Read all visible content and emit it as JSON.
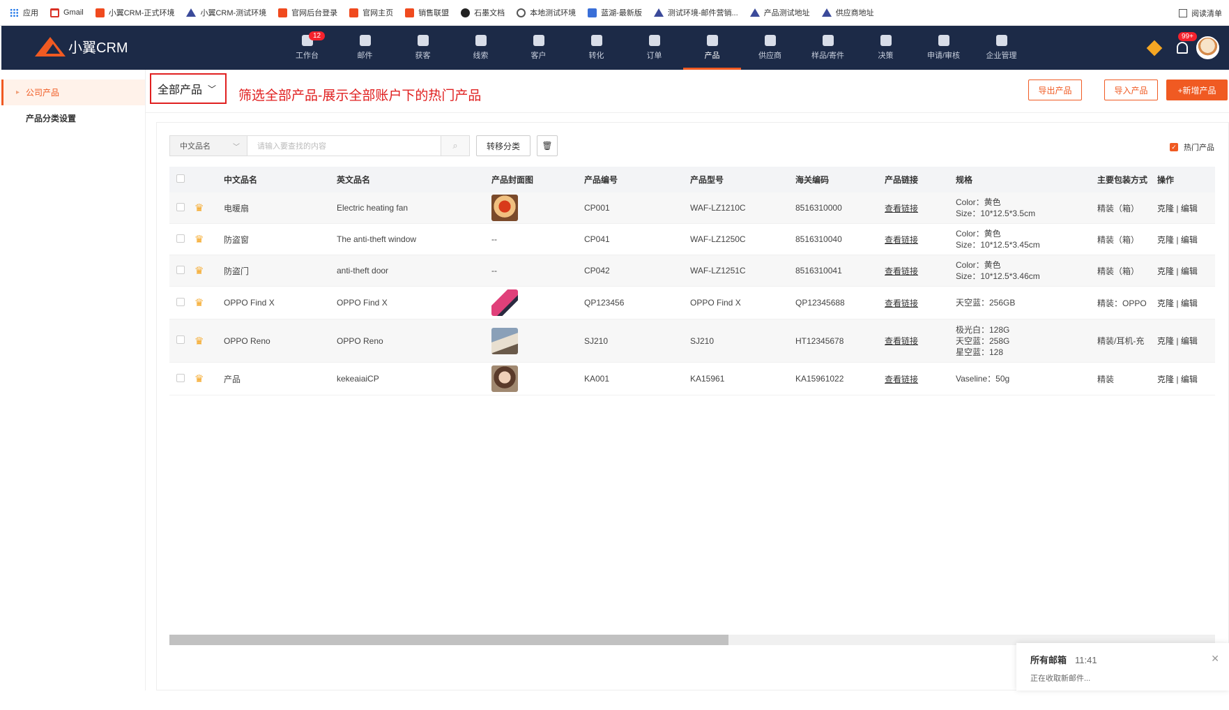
{
  "bookmarks": {
    "items": [
      {
        "label": "应用",
        "icon": "apps-grid-icon"
      },
      {
        "label": "Gmail",
        "icon": "gmail-icon"
      },
      {
        "label": "小翼CRM-正式环境",
        "icon": "crm-icon"
      },
      {
        "label": "小翼CRM-测试环境",
        "icon": "triangle-icon"
      },
      {
        "label": "官网后台登录",
        "icon": "crm-icon"
      },
      {
        "label": "官网主页",
        "icon": "crm-icon"
      },
      {
        "label": "销售联盟",
        "icon": "crm-icon"
      },
      {
        "label": "石墨文档",
        "icon": "shimo-icon"
      },
      {
        "label": "本地测试环境",
        "icon": "globe-icon"
      },
      {
        "label": "蓝湖-最新版",
        "icon": "lanhu-icon"
      },
      {
        "label": "测试环境-邮件营销...",
        "icon": "triangle-icon"
      },
      {
        "label": "产品测试地址",
        "icon": "triangle-icon"
      },
      {
        "label": "供应商地址",
        "icon": "triangle-icon"
      }
    ],
    "reading_list": "阅读清单"
  },
  "nav": {
    "brand": "小翼CRM",
    "items": [
      {
        "label": "工作台",
        "badge": "12"
      },
      {
        "label": "邮件"
      },
      {
        "label": "获客"
      },
      {
        "label": "线索"
      },
      {
        "label": "客户"
      },
      {
        "label": "转化"
      },
      {
        "label": "订单"
      },
      {
        "label": "产品",
        "active": true
      },
      {
        "label": "供应商"
      },
      {
        "label": "样品/寄件"
      },
      {
        "label": "决策"
      },
      {
        "label": "申请/审核"
      },
      {
        "label": "企业管理"
      }
    ],
    "notification_badge": "99+"
  },
  "sidebar": {
    "items": [
      {
        "label": "公司产品",
        "active": true
      },
      {
        "label": "产品分类设置"
      }
    ]
  },
  "filter": {
    "selected": "全部产品",
    "annotation": "筛选全部产品-展示全部账户下的热门产品"
  },
  "actions": {
    "export": "导出产品",
    "import": "导入产品",
    "add": "+新增产品"
  },
  "toolbar": {
    "search_type": "中文品名",
    "search_placeholder": "请输入要查找的内容",
    "move_category": "转移分类",
    "hot_label": "热门产品"
  },
  "table": {
    "headers": {
      "cn": "中文品名",
      "en": "英文品名",
      "img": "产品封面图",
      "code": "产品编号",
      "model": "产品型号",
      "hs": "海关编码",
      "link": "产品链接",
      "spec": "规格",
      "pack": "主要包装方式",
      "op": "操作"
    },
    "rows": [
      {
        "cn": "电暖扇",
        "en": "Electric heating fan",
        "img": "thumb",
        "code": "CP001",
        "model": "WAF-LZ1210C",
        "hs": "8516310000",
        "link": "查看链接",
        "spec": [
          "Color：黄色",
          "Size：10*12.5*3.5cm"
        ],
        "pack": "精装（箱）",
        "clone": "克隆",
        "edit": "编辑"
      },
      {
        "cn": "防盗窗",
        "en": "The anti-theft window",
        "img": "--",
        "code": "CP041",
        "model": "WAF-LZ1250C",
        "hs": "8516310040",
        "link": "查看链接",
        "spec": [
          "Color：黄色",
          "Size：10*12.5*3.45cm"
        ],
        "pack": "精装（箱）",
        "clone": "克隆",
        "edit": "编辑"
      },
      {
        "cn": "防盗门",
        "en": "anti-theft door",
        "img": "--",
        "code": "CP042",
        "model": "WAF-LZ1251C",
        "hs": "8516310041",
        "link": "查看链接",
        "spec": [
          "Color：黄色",
          "Size：10*12.5*3.46cm"
        ],
        "pack": "精装（箱）",
        "clone": "克隆",
        "edit": "编辑"
      },
      {
        "cn": "OPPO Find X",
        "en": "OPPO Find X",
        "img": "thumb",
        "code": "QP123456",
        "model": "OPPO Find X",
        "hs": "QP12345688",
        "link": "查看链接",
        "spec": [
          "天空蓝：256GB"
        ],
        "pack": "精装：OPPO",
        "clone": "克隆",
        "edit": "编辑"
      },
      {
        "cn": "OPPO Reno",
        "en": "OPPO Reno",
        "img": "thumb",
        "code": "SJ210",
        "model": "SJ210",
        "hs": "HT12345678",
        "link": "查看链接",
        "spec": [
          "极光白：128G",
          "天空蓝：258G",
          "星空蓝：128"
        ],
        "pack": "精装/耳机-充",
        "clone": "克隆",
        "edit": "编辑"
      },
      {
        "cn": "产品",
        "en": "kekeaiaiCP",
        "img": "thumb",
        "code": "KA001",
        "model": "KA15961",
        "hs": "KA15961022",
        "link": "查看链接",
        "spec": [
          "Vaseline：50g"
        ],
        "pack": "精装",
        "clone": "克隆",
        "edit": "编辑"
      }
    ]
  },
  "toast": {
    "title": "所有邮箱",
    "time": "11:41",
    "message": "正在收取新邮件..."
  }
}
